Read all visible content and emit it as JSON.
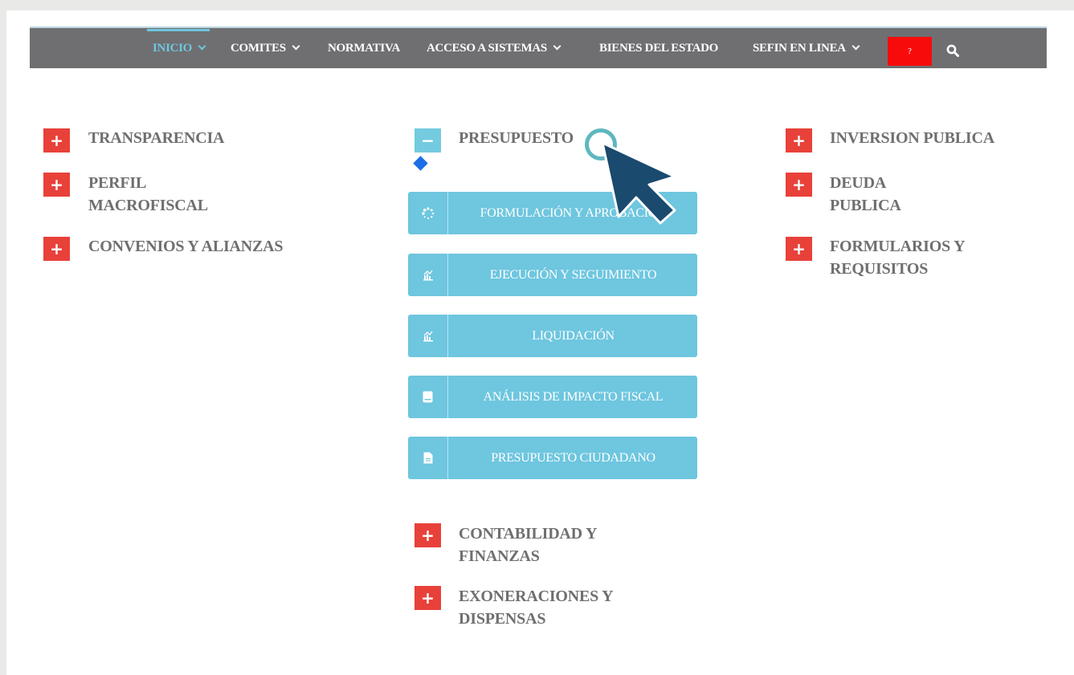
{
  "nav": {
    "items": [
      {
        "label": "INICIO",
        "dropdown": true,
        "active": true
      },
      {
        "label": "COMITES",
        "dropdown": true
      },
      {
        "label": "NORMATIVA",
        "dropdown": false
      },
      {
        "label": "ACCESO A SISTEMAS",
        "dropdown": true
      },
      {
        "label": "BIENES DEL ESTADO",
        "dropdown": false
      },
      {
        "label": "SEFIN EN LINEA",
        "dropdown": true
      }
    ],
    "help_label": "?",
    "search_icon": "search-icon"
  },
  "left_column": [
    {
      "label_lines": [
        "TRANSPARENCIA"
      ]
    },
    {
      "label_lines": [
        "PERFIL",
        "MACROFISCAL"
      ]
    },
    {
      "label_lines": [
        "CONVENIOS Y ALIANZAS"
      ]
    }
  ],
  "center_column": {
    "expanded": {
      "label": "PRESUPUESTO",
      "toggle": "−"
    },
    "sub_items": [
      {
        "label": "FORMULACIÓN Y APROBACIÓN",
        "icon": "spinner-icon"
      },
      {
        "label": "EJECUCIÓN Y SEGUIMIENTO",
        "icon": "chart-icon"
      },
      {
        "label": "LIQUIDACIÓN",
        "icon": "chart-icon"
      },
      {
        "label": "ANÁLISIS DE IMPACTO FISCAL",
        "icon": "book-icon"
      },
      {
        "label": "PRESUPUESTO CIUDADANO",
        "icon": "document-icon"
      }
    ],
    "collapsed": [
      {
        "label_lines": [
          "CONTABILIDAD Y",
          "FINANZAS"
        ]
      },
      {
        "label_lines": [
          "EXONERACIONES Y",
          "DISPENSAS"
        ]
      }
    ]
  },
  "right_column": [
    {
      "label_lines": [
        "INVERSION PUBLICA"
      ]
    },
    {
      "label_lines": [
        "DEUDA",
        "PUBLICA"
      ]
    },
    {
      "label_lines": [
        "FORMULARIOS Y",
        "REQUISITOS"
      ]
    }
  ],
  "toggle_plus": "+",
  "colors": {
    "nav_bg": "#6f6f71",
    "nav_active": "#6fc7df",
    "plus_red": "#e8413a",
    "sub_button": "#6ec6df",
    "text_grey": "#6f6f71",
    "cursor": "#1a4a6e",
    "help_red": "#f80b0b"
  }
}
